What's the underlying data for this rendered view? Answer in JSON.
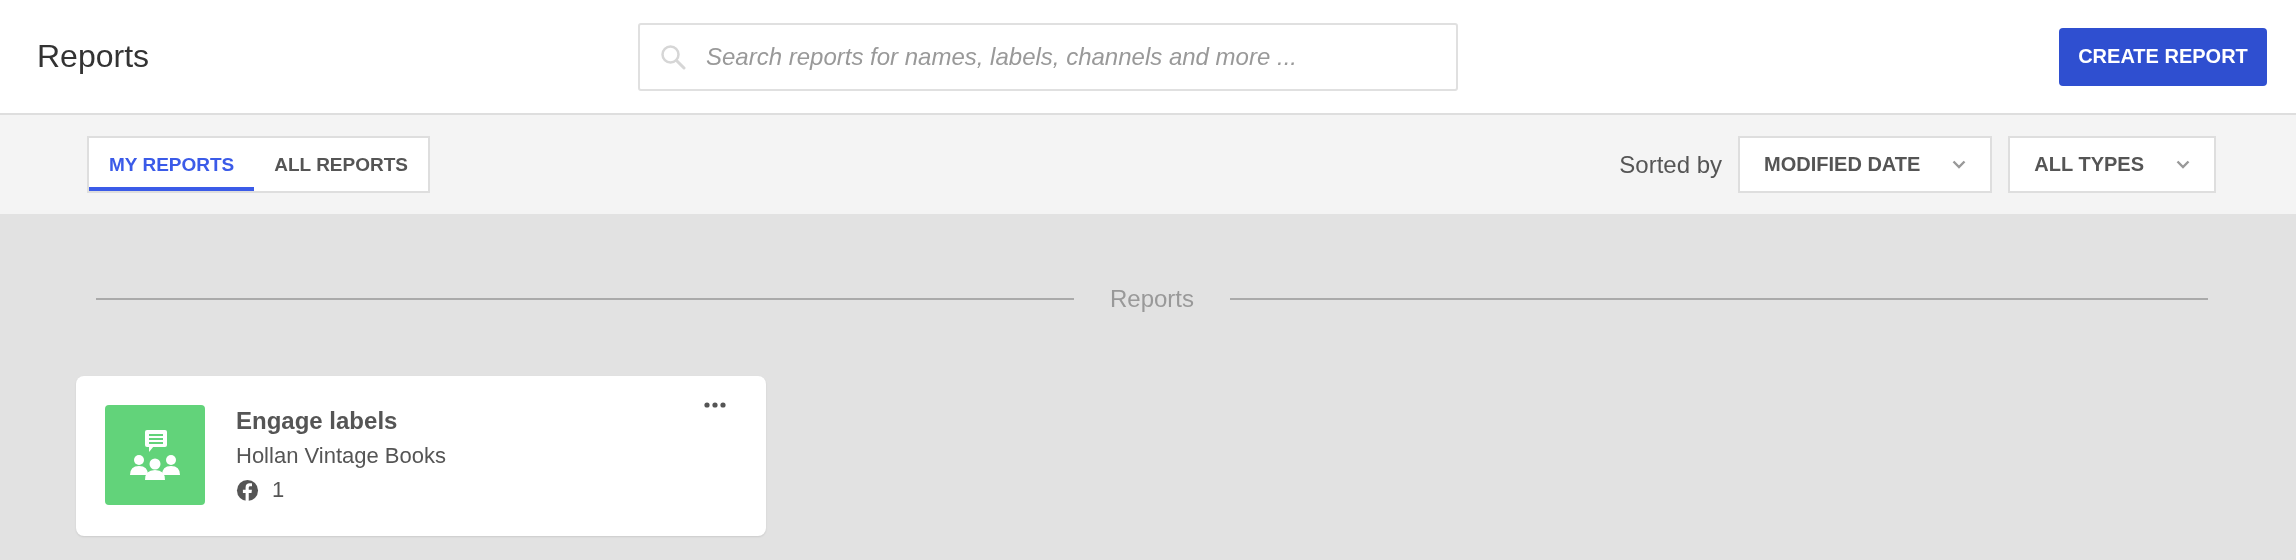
{
  "header": {
    "title": "Reports",
    "search": {
      "placeholder": "Search reports for names, labels, channels and more ..."
    },
    "create_button": "CREATE REPORT"
  },
  "tabs": [
    {
      "label": "MY REPORTS",
      "selected": true
    },
    {
      "label": "ALL REPORTS",
      "selected": false
    }
  ],
  "sort": {
    "label": "Sorted by",
    "dropdowns": [
      "MODIFIED DATE",
      "ALL TYPES"
    ]
  },
  "section": {
    "title": "Reports"
  },
  "reports": [
    {
      "title": "Engage labels",
      "subtitle": "Hollan Vintage Books",
      "count": "1",
      "color": "#62d37a"
    }
  ]
}
